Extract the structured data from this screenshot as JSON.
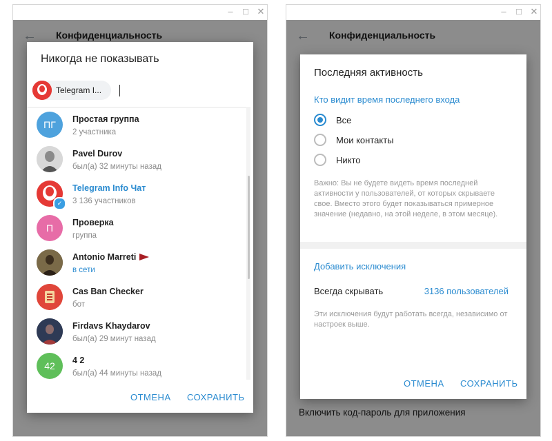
{
  "left_window": {
    "app_title": "Конфиденциальность",
    "dialog": {
      "title": "Никогда не показывать",
      "chip_label": "Telegram I...",
      "items": [
        {
          "name": "Простая группа",
          "sub": "2 участника",
          "initials": "ПГ",
          "color": "#4ea2dd"
        },
        {
          "name": "Pavel Durov",
          "sub": "был(а) 32 минуты назад",
          "initials": "",
          "color": "#bcbcbc"
        },
        {
          "name": "Telegram Info Чат",
          "sub": "3 136 участников",
          "initials": "",
          "color": "#e53935"
        },
        {
          "name": "Проверка",
          "sub": "группа",
          "initials": "П",
          "color": "#e76ca7"
        },
        {
          "name": "Antonio Marreti",
          "sub": "в сети",
          "initials": "",
          "color": "#6b5a3e"
        },
        {
          "name": "Cas Ban Checker",
          "sub": "бот",
          "initials": "",
          "color": "#e0463a"
        },
        {
          "name": "Firdavs Khaydarov",
          "sub": "был(а) 29 минут назад",
          "initials": "",
          "color": "#3d4a63"
        },
        {
          "name": "4 2",
          "sub": "был(а) 44 минуты назад",
          "initials": "42",
          "color": "#5fbf5a"
        }
      ],
      "cancel": "ОТМЕНА",
      "save": "СОХРАНИТЬ"
    }
  },
  "right_window": {
    "app_title": "Конфиденциальность",
    "bottom_row": "Включить код-пароль для приложения",
    "dialog": {
      "title": "Последняя активность",
      "section": "Кто видит время последнего входа",
      "options": [
        "Все",
        "Мои контакты",
        "Никто"
      ],
      "selected": "Все",
      "note": "Важно: Вы не будете видеть время последней активности у пользователей, от которых скрываете свое. Вместо этого будет показываться примерное значение (недавно, на этой неделе, в этом месяце).",
      "exceptions_head": "Добавить исключения",
      "always_hide_label": "Всегда скрывать",
      "always_hide_value": "3136 пользователей",
      "exceptions_note": "Эти исключения будут работать всегда, независимо от настроек выше.",
      "cancel": "ОТМЕНА",
      "save": "СОХРАНИТЬ"
    }
  },
  "window_controls": [
    "minimize-icon",
    "maximize-icon",
    "close-icon"
  ]
}
